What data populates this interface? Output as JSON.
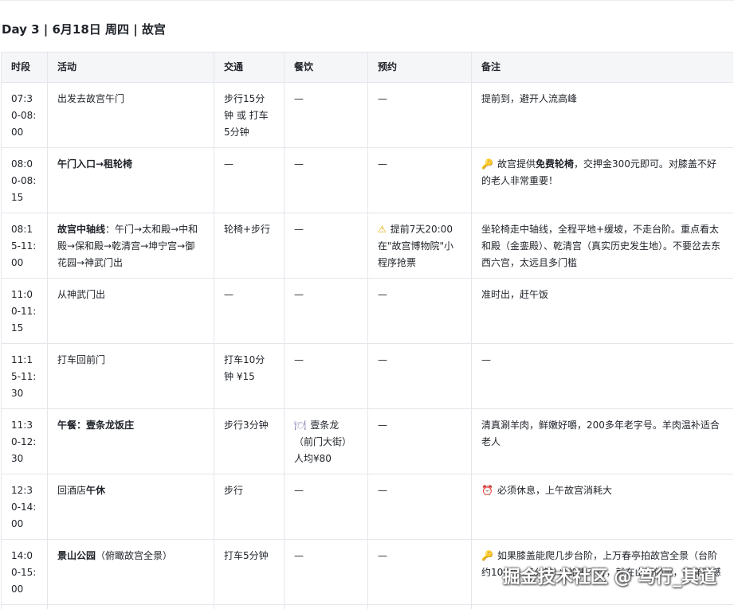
{
  "heading": "Day 3 | 6月18日 周四 | 故宫",
  "table": {
    "headers": [
      "时段",
      "活动",
      "交通",
      "餐饮",
      "预约",
      "备注"
    ],
    "rows": [
      {
        "time": "07:30-08:00",
        "activity": [
          {
            "text": "出发去故宫午门",
            "bold": false
          }
        ],
        "transport": "步行15分钟 或 打车5分钟",
        "dining": {
          "text": "—"
        },
        "booking": {
          "text": "—"
        },
        "notes": {
          "segments": [
            {
              "text": "提前到，避开人流高峰",
              "bold": false
            }
          ]
        }
      },
      {
        "time": "08:00-08:15",
        "activity": [
          {
            "text": "午门入口→租轮椅",
            "bold": true
          }
        ],
        "transport": "—",
        "dining": {
          "text": "—"
        },
        "booking": {
          "text": "—"
        },
        "notes": {
          "icon": "key-icon",
          "glyph": "🔑",
          "segments": [
            {
              "text": "故宫提供",
              "bold": false
            },
            {
              "text": "免费轮椅",
              "bold": true
            },
            {
              "text": "，交押金300元即可。对膝盖不好的老人非常重要！",
              "bold": false
            }
          ]
        }
      },
      {
        "time": "08:15-11:00",
        "activity": [
          {
            "text": "故宫中轴线",
            "bold": true
          },
          {
            "text": "：午门→太和殿→中和殿→保和殿→乾清宫→坤宁宫→御花园→神武门出",
            "bold": false
          }
        ],
        "transport": "轮椅+步行",
        "dining": {
          "text": "—"
        },
        "booking": {
          "icon": "warning-icon",
          "glyph": "⚠",
          "text": "提前7天20:00在\"故宫博物院\"小程序抢票"
        },
        "notes": {
          "segments": [
            {
              "text": "坐轮椅走中轴线，全程平地+缓坡，不走台阶。重点看太和殿（金銮殿）、乾清宫（真实历史发生地）。不要岔去东西六宫，太远且多门槛",
              "bold": false
            }
          ]
        }
      },
      {
        "time": "11:00-11:15",
        "activity": [
          {
            "text": "从神武门出",
            "bold": false
          }
        ],
        "transport": "—",
        "dining": {
          "text": "—"
        },
        "booking": {
          "text": "—"
        },
        "notes": {
          "segments": [
            {
              "text": "准时出，赶午饭",
              "bold": false
            }
          ]
        }
      },
      {
        "time": "11:15-11:30",
        "activity": [
          {
            "text": "打车回前门",
            "bold": false
          }
        ],
        "transport": "打车10分钟 ¥15",
        "dining": {
          "text": "—"
        },
        "booking": {
          "text": "—"
        },
        "notes": {
          "segments": [
            {
              "text": "—",
              "bold": false
            }
          ]
        }
      },
      {
        "time": "11:30-12:30",
        "activity": [
          {
            "text": "午餐：壹条龙饭庄",
            "bold": true
          }
        ],
        "transport": "步行3分钟",
        "dining": {
          "icon": "bowl-icon",
          "glyph": "🍽",
          "text": "壹条龙（前门大街）人均¥80"
        },
        "booking": {
          "text": "—"
        },
        "notes": {
          "segments": [
            {
              "text": "清真涮羊肉，鲜嫩好嚼，200多年老字号。羊肉温补适合老人",
              "bold": false
            }
          ]
        }
      },
      {
        "time": "12:30-14:00",
        "activity": [
          {
            "text": "回酒店",
            "bold": false
          },
          {
            "text": "午休",
            "bold": true
          }
        ],
        "transport": "步行",
        "dining": {
          "text": "—"
        },
        "booking": {
          "text": "—"
        },
        "notes": {
          "icon": "alarm-clock-icon",
          "glyph": "⏰",
          "segments": [
            {
              "text": "必须休息，上午故宫消耗大",
              "bold": false
            }
          ]
        }
      },
      {
        "time": "14:00-15:00",
        "activity": [
          {
            "text": "景山公园",
            "bold": true
          },
          {
            "text": "（俯瞰故宫全景）",
            "bold": false
          }
        ],
        "transport": "打车5分钟",
        "dining": {
          "text": "—"
        },
        "booking": {
          "text": "—"
        },
        "notes": {
          "icon": "key-icon",
          "glyph": "🔑",
          "segments": [
            {
              "text": "如果膝盖能爬几步台阶，上万春亭拍故宫全景（台阶约100级，5分钟）；如果不行，就在山脚仰望，同样震撼",
              "bold": false
            }
          ]
        }
      }
    ]
  },
  "watermark": "掘金技术社区 @ 笃行_其道"
}
